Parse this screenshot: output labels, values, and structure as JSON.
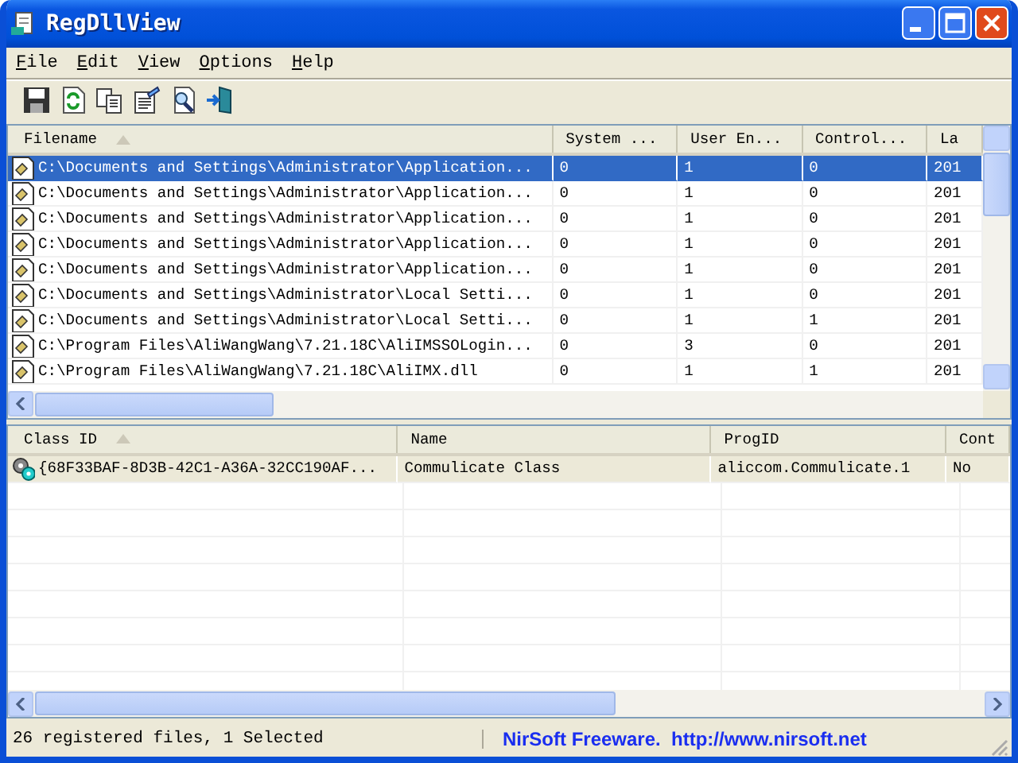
{
  "window": {
    "title": "RegDllView"
  },
  "menu": [
    {
      "label": "File"
    },
    {
      "label": "Edit"
    },
    {
      "label": "View"
    },
    {
      "label": "Options"
    },
    {
      "label": "Help"
    }
  ],
  "toolbar": [
    {
      "kind": "save"
    },
    {
      "kind": "refresh"
    },
    {
      "kind": "copy"
    },
    {
      "kind": "properties"
    },
    {
      "kind": "find"
    },
    {
      "kind": "exit"
    }
  ],
  "files": {
    "columns": [
      {
        "label": "Filename",
        "sorted": true
      },
      {
        "label": "System ...",
        "sorted": false
      },
      {
        "label": "User En...",
        "sorted": false
      },
      {
        "label": "Control...",
        "sorted": false
      },
      {
        "label": "La",
        "sorted": false
      }
    ],
    "rows": [
      {
        "selected": true,
        "cells": [
          "C:\\Documents and Settings\\Administrator\\Application...",
          "0",
          "1",
          "0",
          "201"
        ]
      },
      {
        "selected": false,
        "cells": [
          "C:\\Documents and Settings\\Administrator\\Application...",
          "0",
          "1",
          "0",
          "201"
        ]
      },
      {
        "selected": false,
        "cells": [
          "C:\\Documents and Settings\\Administrator\\Application...",
          "0",
          "1",
          "0",
          "201"
        ]
      },
      {
        "selected": false,
        "cells": [
          "C:\\Documents and Settings\\Administrator\\Application...",
          "0",
          "1",
          "0",
          "201"
        ]
      },
      {
        "selected": false,
        "cells": [
          "C:\\Documents and Settings\\Administrator\\Application...",
          "0",
          "1",
          "0",
          "201"
        ]
      },
      {
        "selected": false,
        "cells": [
          "C:\\Documents and Settings\\Administrator\\Local Setti...",
          "0",
          "1",
          "0",
          "201"
        ]
      },
      {
        "selected": false,
        "cells": [
          "C:\\Documents and Settings\\Administrator\\Local Setti...",
          "0",
          "1",
          "1",
          "201"
        ]
      },
      {
        "selected": false,
        "cells": [
          "C:\\Program Files\\AliWangWang\\7.21.18C\\AliIMSSOLogin...",
          "0",
          "3",
          "0",
          "201"
        ]
      },
      {
        "selected": false,
        "cells": [
          "C:\\Program Files\\AliWangWang\\7.21.18C\\AliIMX.dll",
          "0",
          "1",
          "1",
          "201"
        ]
      }
    ]
  },
  "classes": {
    "columns": [
      {
        "label": "Class ID",
        "sorted": true
      },
      {
        "label": "Name",
        "sorted": false
      },
      {
        "label": "ProgID",
        "sorted": false
      },
      {
        "label": "Cont",
        "sorted": false
      }
    ],
    "rows": [
      {
        "selected": true,
        "cells": [
          "{68F33BAF-8D3B-42C1-A36A-32CC190AF...",
          "Commulicate Class",
          "aliccom.Commulicate.1",
          "No"
        ]
      }
    ]
  },
  "status_bar": {
    "text": "26 registered files, 1 Selected",
    "link": "NirSoft Freeware.  http://www.nirsoft.net"
  }
}
